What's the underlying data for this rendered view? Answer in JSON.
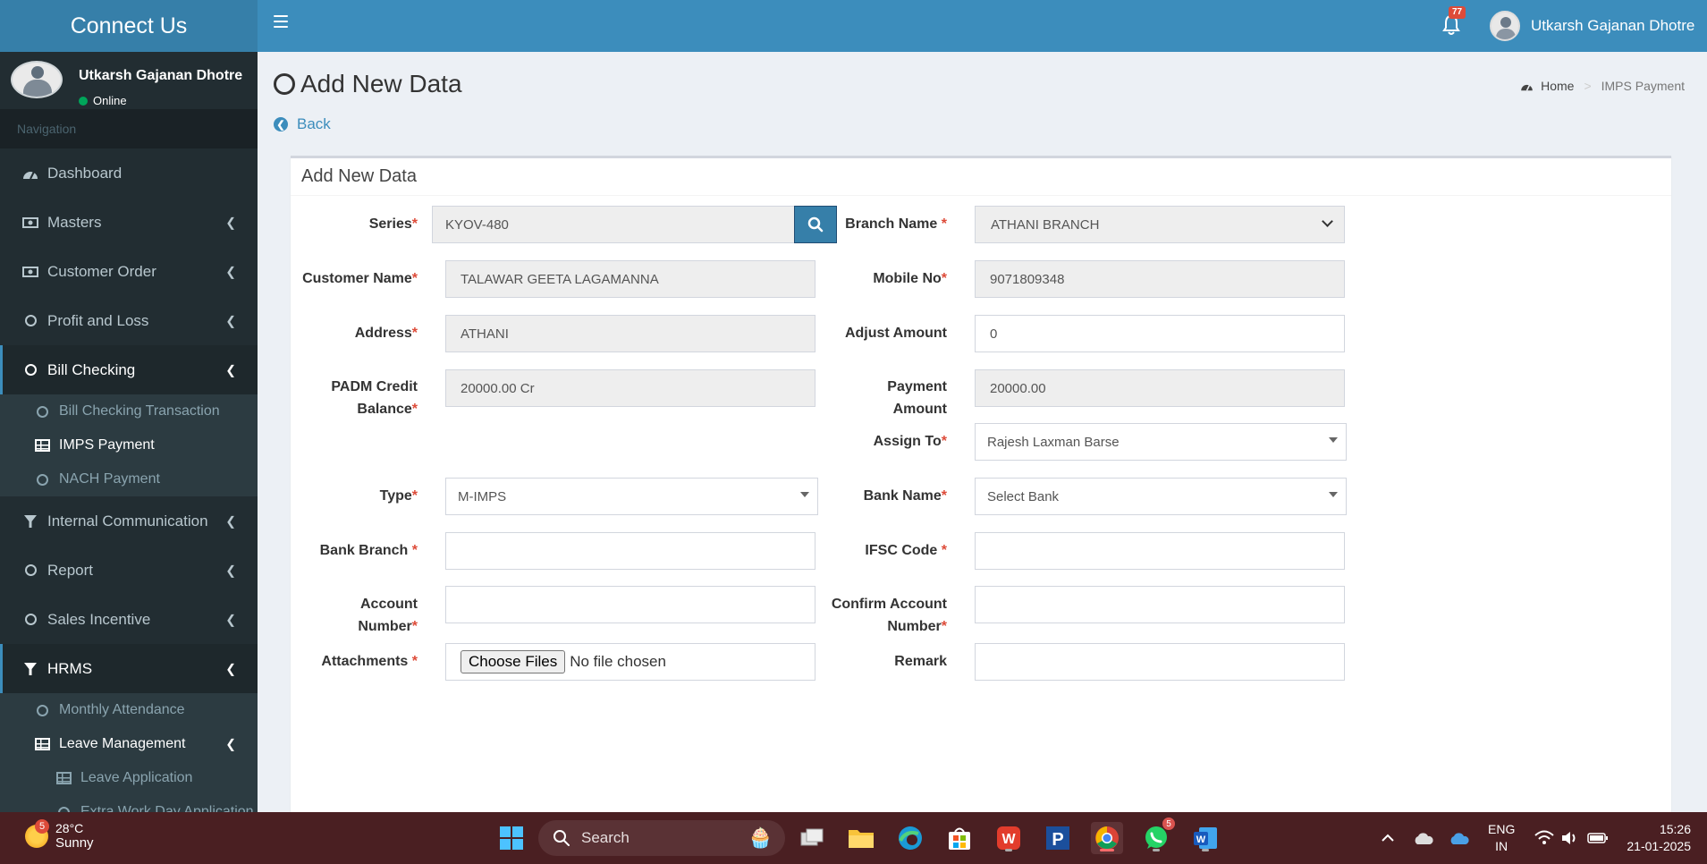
{
  "header": {
    "logo_text": "Connect Us",
    "notification_count": "77",
    "user_name": "Utkarsh Gajanan Dhotre"
  },
  "sidebar": {
    "user_name": "Utkarsh Gajanan Dhotre",
    "status": "Online",
    "nav_header": "Navigation",
    "items": [
      {
        "label": "Dashboard",
        "icon": "dashboard-icon"
      },
      {
        "label": "Masters",
        "icon": "money-icon"
      },
      {
        "label": "Customer Order",
        "icon": "money-icon"
      },
      {
        "label": "Profit and Loss",
        "icon": "circle-icon"
      },
      {
        "label": "Bill Checking",
        "icon": "circle-icon"
      },
      {
        "label": "Internal Communication",
        "icon": "funnel-icon"
      },
      {
        "label": "Report",
        "icon": "circle-icon"
      },
      {
        "label": "Sales Incentive",
        "icon": "circle-icon"
      },
      {
        "label": "HRMS",
        "icon": "funnel-icon"
      }
    ],
    "bill_checking_sub": [
      "Bill Checking Transaction",
      "IMPS Payment",
      "NACH Payment"
    ],
    "hrms_sub": [
      "Monthly Attendance",
      "Leave Management"
    ],
    "leave_sub": [
      "Leave Application",
      "Extra Work Day Application"
    ]
  },
  "page": {
    "title": "Add New Data",
    "back": "Back",
    "breadcrumb_home": "Home",
    "breadcrumb_current": "IMPS Payment"
  },
  "form": {
    "box_title": "Add New Data",
    "series_label": "Series",
    "series_value": "KYOV-480",
    "branch_label": "Branch Name",
    "branch_value": "ATHANI BRANCH",
    "customer_label": "Customer Name",
    "customer_value": "TALAWAR GEETA LAGAMANNA",
    "mobile_label": "Mobile No",
    "mobile_value": "9071809348",
    "address_label": "Address",
    "address_value": "ATHANI",
    "adjust_label": "Adjust Amount",
    "adjust_value": "0",
    "padm_label_1": "PADM Credit",
    "padm_label_2": "Balance",
    "padm_value": "20000.00 Cr",
    "payment_label": "Payment Amount",
    "payment_value": "20000.00",
    "assign_label": "Assign To",
    "assign_value": "Rajesh Laxman Barse",
    "type_label": "Type",
    "type_value": "M-IMPS",
    "bank_name_label": "Bank Name",
    "bank_name_value": "Select Bank",
    "bank_branch_label": "Bank Branch",
    "bank_branch_value": "",
    "ifsc_label": "IFSC Code",
    "ifsc_value": "",
    "account_label": "Account Number",
    "account_value": "",
    "confirm_label_1": "Confirm Account",
    "confirm_label_2": "Number",
    "confirm_value": "",
    "attachments_label": "Attachments",
    "choose_files": "Choose Files",
    "no_file": "No file chosen",
    "remark_label": "Remark",
    "remark_value": "",
    "required_mark": "*"
  },
  "taskbar": {
    "weather_temp": "28°C",
    "weather_desc": "Sunny",
    "weather_badge": "5",
    "search": "Search",
    "whatsapp_badge": "5",
    "lang_1": "ENG",
    "lang_2": "IN",
    "time": "15:26",
    "date": "21-01-2025"
  },
  "colors": {
    "header": "#3c8dbc",
    "logo_bg": "#367fa9",
    "sidebar": "#222d32",
    "required": "#dd4b39",
    "taskbar": "#4a1f22"
  }
}
